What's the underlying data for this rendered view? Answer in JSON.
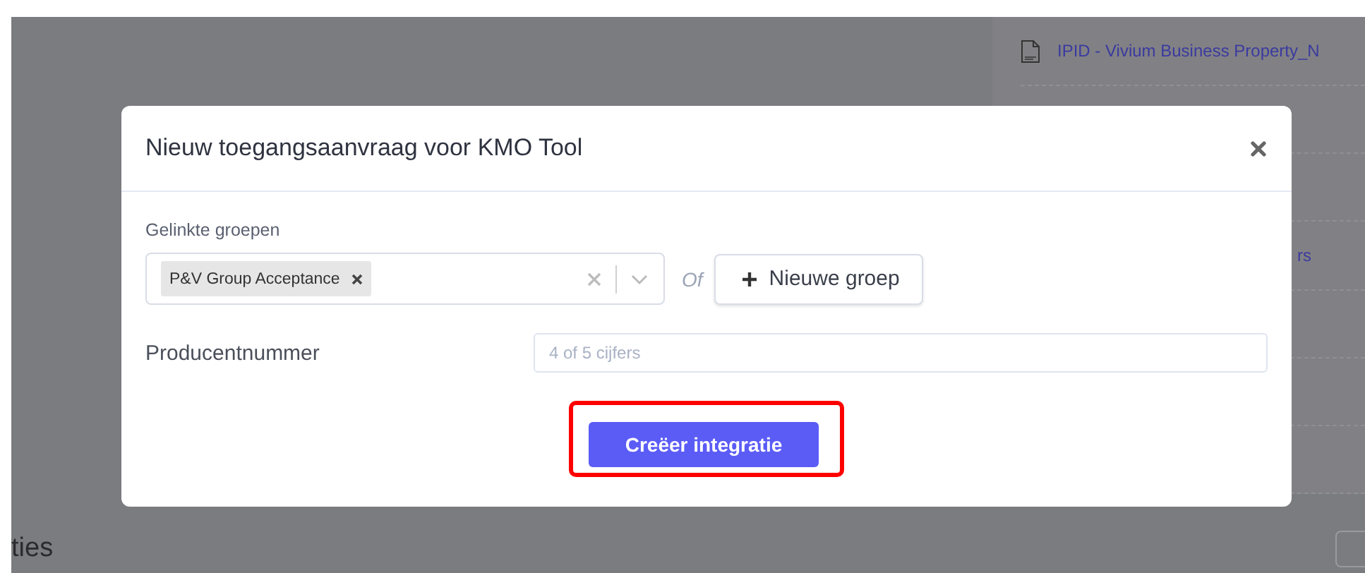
{
  "background": {
    "document_link": "IPID - Vivium Business Property_N",
    "link_fragment": "rs",
    "section_heading_fragment": "ties"
  },
  "dialog": {
    "title": "Nieuw toegangsaanvraag voor KMO Tool",
    "fields": [
      {
        "kind": "multiselect",
        "label": "Gelinkte groepen",
        "tags": [
          {
            "label": "P&V Group Acceptance"
          }
        ],
        "separator": "Of",
        "add_button": "Nieuwe groep"
      },
      {
        "kind": "text",
        "label": "Producentnummer",
        "placeholder": "4 of 5 cijfers"
      }
    ],
    "submit": "Creëer integratie"
  }
}
